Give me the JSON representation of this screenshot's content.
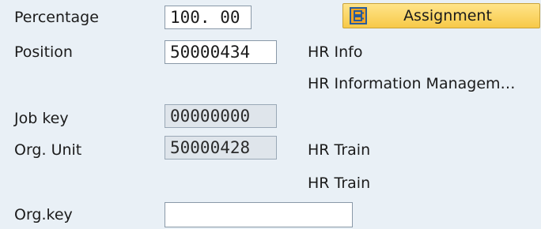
{
  "form": {
    "percentage": {
      "label": "Percentage",
      "value": "100. 00"
    },
    "position": {
      "label": "Position",
      "value": "50000434",
      "desc1": "HR Info",
      "desc2": "HR Information Managem…"
    },
    "job_key": {
      "label": "Job key",
      "value": "00000000"
    },
    "org_unit": {
      "label": "Org. Unit",
      "value": "50000428",
      "desc1": "HR Train",
      "desc2": "HR Train"
    },
    "org_key": {
      "label": "Org.key",
      "value": ""
    }
  },
  "toolbar": {
    "assignment_label": "Assignment",
    "assignment_icon": "assignment-icon"
  },
  "colors": {
    "background": "#e9f0f6",
    "button": "#f7c948",
    "field_readonly": "#dfe5eb"
  }
}
